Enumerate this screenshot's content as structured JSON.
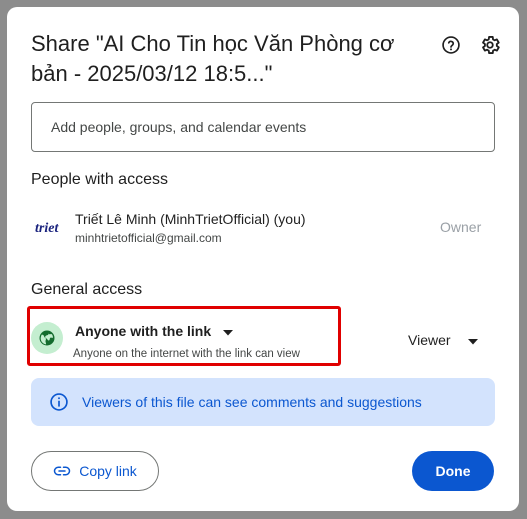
{
  "dialog": {
    "title": "Share \"AI Cho Tin học Văn Phòng cơ bản - 2025/03/12 18:5...\"",
    "help_icon": "help-circle-icon",
    "settings_icon": "gear-icon"
  },
  "add_people": {
    "placeholder": "Add people, groups, and calendar events"
  },
  "people_with_access": {
    "heading": "People with access",
    "people": [
      {
        "logo_text": "triet",
        "name": "Triết Lê Minh (MinhTrietOfficial) (you)",
        "email": "minhtrietofficial@gmail.com",
        "role": "Owner"
      }
    ]
  },
  "general_access": {
    "heading": "General access",
    "icon": "globe-icon",
    "selected": "Anyone with the link",
    "description": "Anyone on the internet with the link can view",
    "role": "Viewer"
  },
  "info_banner": {
    "icon": "info-icon",
    "text": "Viewers of this file can see comments and suggestions"
  },
  "footer": {
    "copy_link_label": "Copy link",
    "copy_link_icon": "link-icon",
    "done_label": "Done"
  },
  "colors": {
    "accent": "#0b57d0",
    "banner_bg": "#d3e3fd",
    "globe_bg": "#c4eed0",
    "highlight": "#e00000"
  }
}
